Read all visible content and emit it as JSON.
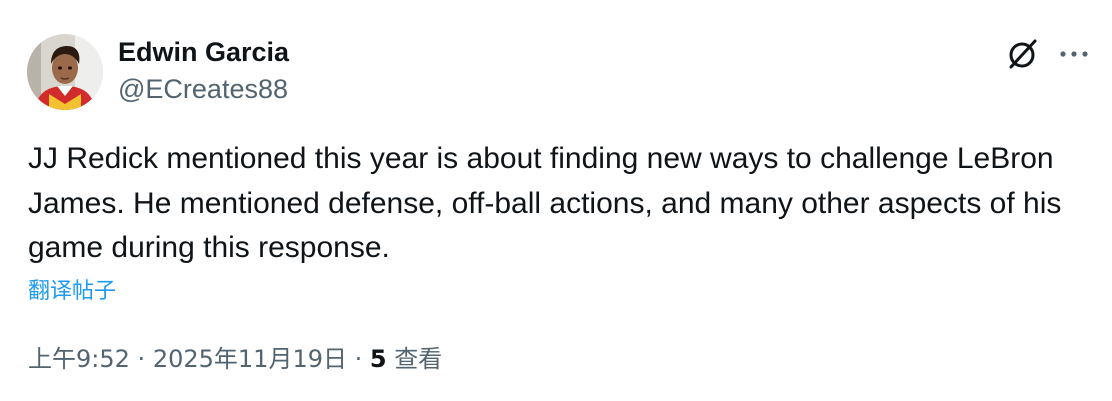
{
  "author": {
    "display_name": "Edwin Garcia",
    "handle": "@ECreates88"
  },
  "actions": {
    "grok_icon": "slashed-circle-icon",
    "more_icon": "more-horizontal-icon"
  },
  "tweet": {
    "text": "JJ Redick mentioned this year is about finding new ways to challenge LeBron James. He mentioned defense, off-ball actions, and many other aspects of his game during this response.",
    "translate_label": "翻译帖子"
  },
  "meta": {
    "time": "上午9:52",
    "separator": "·",
    "date": "2025年11月19日",
    "views_count": "5",
    "views_label": "查看"
  },
  "colors": {
    "text_primary": "#0f1419",
    "text_secondary": "#536471",
    "link": "#1d9bf0"
  }
}
